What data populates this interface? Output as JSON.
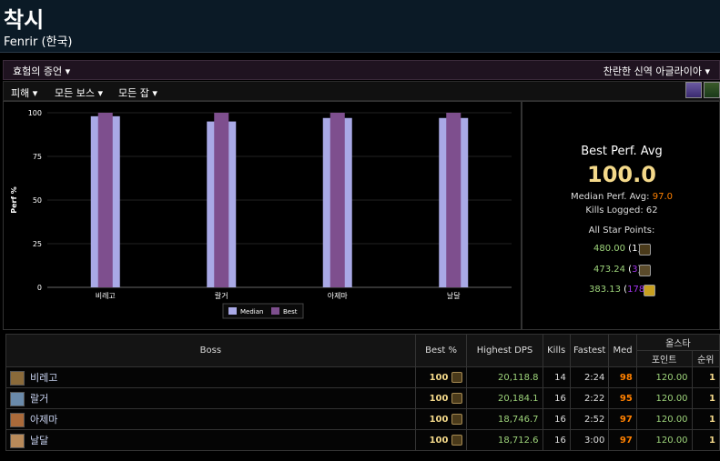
{
  "header": {
    "title": "착시",
    "server": "Fenrir (한국)"
  },
  "filters": {
    "left": "효험의 증언",
    "right": "찬란한 신역 아글라이아",
    "row2": [
      "피해",
      "모든 보스",
      "모든 잡"
    ]
  },
  "summary": {
    "best_perf_label": "Best Perf. Avg",
    "best_perf_value": "100.0",
    "median_label": "Median Perf. Avg:",
    "median_value": "97.0",
    "kills_label": "Kills Logged:",
    "kills_value": "62",
    "star_label": "All Star Points:",
    "stars": [
      {
        "value": "480.00",
        "rank": "1",
        "color": "#f4d98a"
      },
      {
        "value": "473.24",
        "rank": "3",
        "color": "#f4d98a"
      },
      {
        "value": "383.13",
        "rank": "178",
        "color": "#a335ee"
      }
    ]
  },
  "chart_data": {
    "type": "bar",
    "categories": [
      "비레고",
      "랄거",
      "아제마",
      "날달"
    ],
    "series": [
      {
        "name": "Median",
        "values": [
          98,
          95,
          97,
          97
        ],
        "color": "#a9a9e6"
      },
      {
        "name": "Best",
        "values": [
          100,
          100,
          100,
          100
        ],
        "color": "#7e4f8e"
      }
    ],
    "ylabel": "Perf %",
    "ylim": [
      0,
      100
    ],
    "yticks": [
      0,
      25,
      50,
      75,
      100
    ],
    "legend": "bottom"
  },
  "table": {
    "headers": {
      "boss": "Boss",
      "best": "Best %",
      "dps": "Highest DPS",
      "kills": "Kills",
      "fastest": "Fastest",
      "med": "Med",
      "allstar": "올스타",
      "points": "포인트",
      "rank": "순위"
    },
    "rows": [
      {
        "boss": "비레고",
        "best": "100",
        "dps": "20,118.8",
        "kills": "14",
        "fastest": "2:24",
        "med": "98",
        "points": "120.00",
        "rank": "1",
        "avatar": "#8a6a3a"
      },
      {
        "boss": "랄거",
        "best": "100",
        "dps": "20,184.1",
        "kills": "16",
        "fastest": "2:22",
        "med": "95",
        "points": "120.00",
        "rank": "1",
        "avatar": "#6a8aaa"
      },
      {
        "boss": "아제마",
        "best": "100",
        "dps": "18,746.7",
        "kills": "16",
        "fastest": "2:52",
        "med": "97",
        "points": "120.00",
        "rank": "1",
        "avatar": "#aa6a3a"
      },
      {
        "boss": "날달",
        "best": "100",
        "dps": "18,712.6",
        "kills": "16",
        "fastest": "3:00",
        "med": "97",
        "points": "120.00",
        "rank": "1",
        "avatar": "#b88a5a"
      }
    ]
  }
}
